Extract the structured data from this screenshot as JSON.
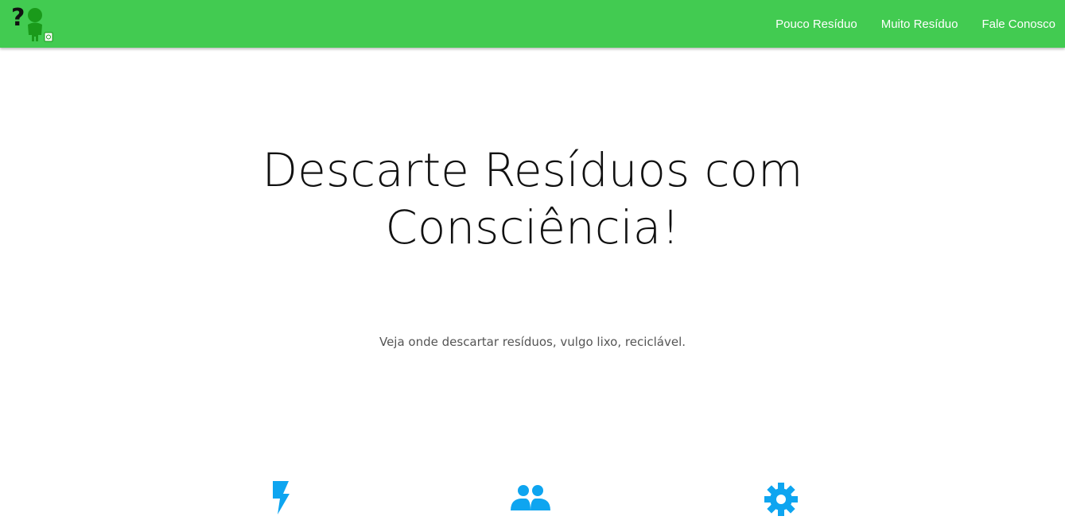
{
  "navbar": {
    "brand_icon": "question-person-recycle-logo",
    "links": [
      {
        "label": "Pouco Resíduo"
      },
      {
        "label": "Muito Resíduo"
      },
      {
        "label": "Fale Conosco"
      }
    ]
  },
  "hero": {
    "title_line1": "Descarte Resíduos com",
    "title_line2": "Consciência!",
    "subtitle": "Veja onde descartar resíduos, vulgo lixo, reciclável."
  },
  "features": {
    "icons": [
      "bolt-icon",
      "users-icon",
      "gear-icon"
    ]
  },
  "colors": {
    "navbar_bg": "#42cb51",
    "icon_blue": "#0ea5f0",
    "logo_green": "#1a9a1a"
  }
}
